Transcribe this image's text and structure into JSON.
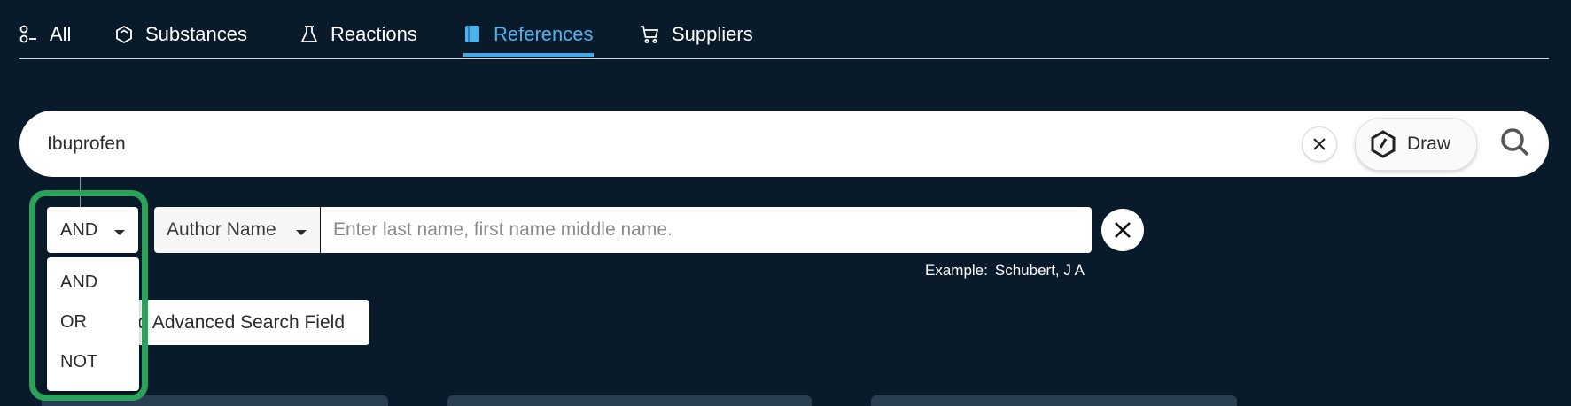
{
  "tabs": [
    {
      "label": "All",
      "icon": "all-icon",
      "active": false
    },
    {
      "label": "Substances",
      "icon": "hexagon-icon",
      "active": false
    },
    {
      "label": "Reactions",
      "icon": "flask-icon",
      "active": false
    },
    {
      "label": "References",
      "icon": "book-icon",
      "active": true
    },
    {
      "label": "Suppliers",
      "icon": "cart-icon",
      "active": false
    }
  ],
  "search": {
    "query": "Ibuprofen",
    "draw_label": "Draw"
  },
  "advanced": {
    "operator_value": "AND",
    "field_value": "Author Name",
    "input_placeholder": "Enter last name, first name middle name.",
    "example_label": "Example:",
    "example_value": "Schubert, J A",
    "add_field_label": "Add Advanced Search Field"
  },
  "operator_menu": {
    "options": [
      "AND",
      "OR",
      "NOT"
    ]
  },
  "colors": {
    "background": "#091a2b",
    "accent": "#3fa9e8",
    "highlight": "#2aa25a"
  }
}
